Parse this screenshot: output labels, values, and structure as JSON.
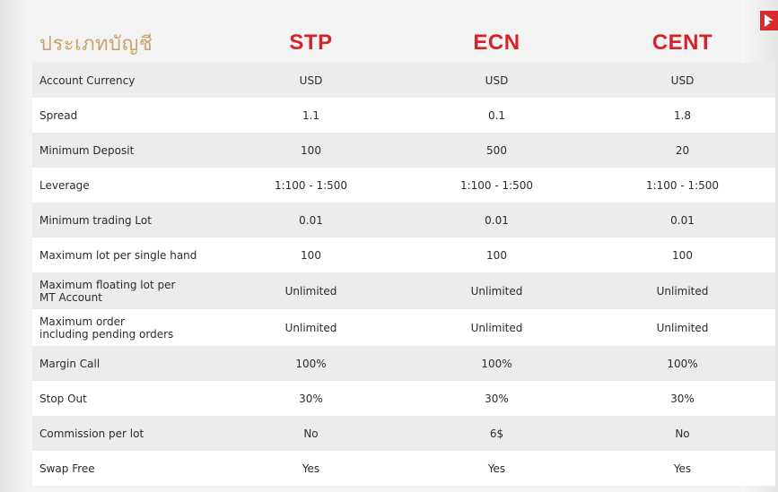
{
  "header": {
    "title": "ประเภทบัญชี",
    "plans": [
      "STP",
      "ECN",
      "CENT"
    ]
  },
  "rows": [
    {
      "label": "Account Currency",
      "values": [
        "USD",
        "USD",
        "USD"
      ]
    },
    {
      "label": "Spread",
      "values": [
        "1.1",
        "0.1",
        "1.8"
      ]
    },
    {
      "label": "Minimum Deposit",
      "values": [
        "100",
        "500",
        "20"
      ]
    },
    {
      "label": "Leverage",
      "values": [
        "1:100 - 1:500",
        "1:100 - 1:500",
        "1:100 - 1:500"
      ]
    },
    {
      "label": "Minimum trading Lot",
      "values": [
        "0.01",
        "0.01",
        "0.01"
      ]
    },
    {
      "label": "Maximum lot per single hand",
      "values": [
        "100",
        "100",
        "100"
      ]
    },
    {
      "label_line1": "Maximum floating lot per",
      "label_line2": "MT Account",
      "values": [
        "Unlimited",
        "Unlimited",
        "Unlimited"
      ]
    },
    {
      "label_line1": "Maximum order",
      "label_line2": "including pending orders",
      "values": [
        "Unlimited",
        "Unlimited",
        "Unlimited"
      ]
    },
    {
      "label": "Margin Call",
      "values": [
        "100%",
        "100%",
        "100%"
      ]
    },
    {
      "label": "Stop Out",
      "values": [
        "30%",
        "30%",
        "30%"
      ]
    },
    {
      "label": "Commission per lot",
      "values": [
        "No",
        "6$",
        "No"
      ]
    },
    {
      "label": "Swap Free",
      "values": [
        "Yes",
        "Yes",
        "Yes"
      ]
    }
  ],
  "colors": {
    "title": "#c9a46a",
    "plan": "#d6232a",
    "row_shaded": "#ececec",
    "row_plain": "#ffffff"
  }
}
